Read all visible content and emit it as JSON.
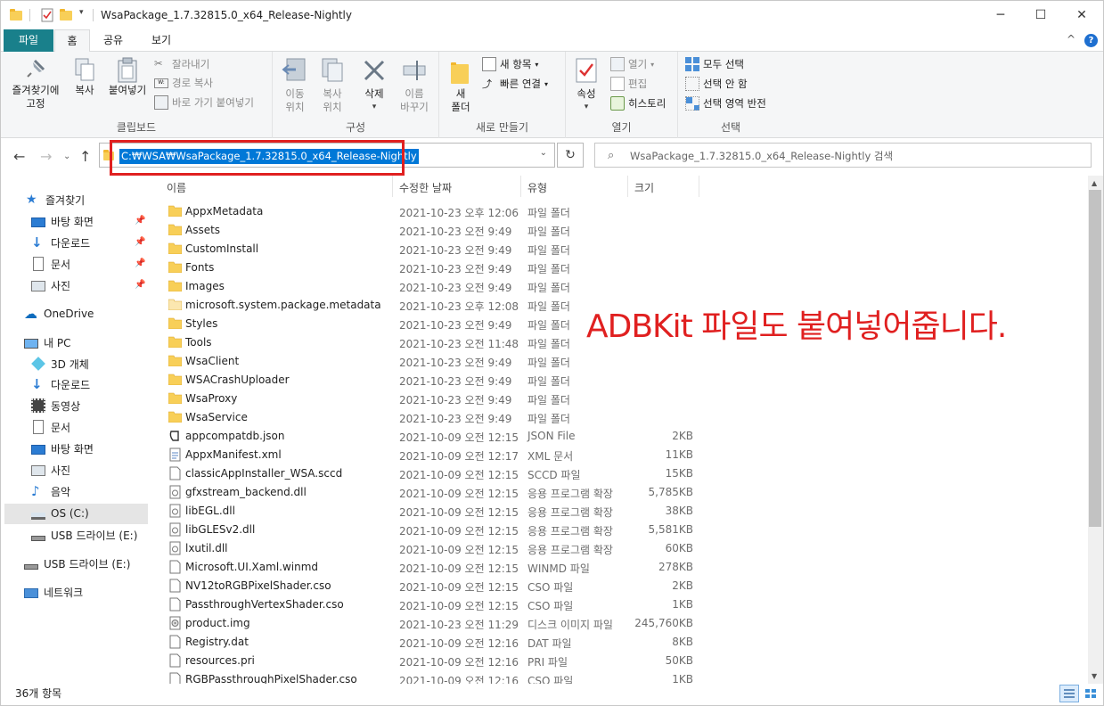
{
  "window": {
    "title": "WsaPackage_1.7.32815.0_x64_Release-Nightly",
    "minimize": "─",
    "maximize": "☐",
    "close": "✕",
    "help": "?",
    "collapse": "^"
  },
  "tabs": {
    "file": "파일",
    "home": "홈",
    "share": "공유",
    "view": "보기"
  },
  "ribbon": {
    "clipboard": {
      "pin_label_1": "즐겨찾기에",
      "pin_label_2": "고정",
      "copy": "복사",
      "paste": "붙여넣기",
      "cut": "잘라내기",
      "copy_path": "경로 복사",
      "paste_shortcut": "바로 가기 붙여넣기",
      "group": "클립보드"
    },
    "organize": {
      "move_1": "이동",
      "move_2": "위치",
      "copyto_1": "복사",
      "copyto_2": "위치",
      "delete": "삭제",
      "rename_1": "이름",
      "rename_2": "바꾸기",
      "group": "구성"
    },
    "new": {
      "new_folder_1": "새",
      "new_folder_2": "폴더",
      "new_item": "새 항목",
      "easy_access": "빠른 연결",
      "group": "새로 만들기"
    },
    "open": {
      "properties": "속성",
      "open": "열기",
      "edit": "편집",
      "history": "히스토리",
      "group": "열기"
    },
    "select": {
      "select_all": "모두 선택",
      "select_none": "선택 안 함",
      "invert": "선택 영역 반전",
      "group": "선택"
    }
  },
  "address": {
    "path": "C:₩WSA₩WsaPackage_1.7.32815.0_x64_Release-Nightly"
  },
  "search": {
    "placeholder": "WsaPackage_1.7.32815.0_x64_Release-Nightly 검색"
  },
  "sidebar": {
    "quick_access": "즐겨찾기",
    "desktop": "바탕 화면",
    "downloads": "다운로드",
    "documents": "문서",
    "pictures": "사진",
    "onedrive": "OneDrive",
    "this_pc": "내 PC",
    "objects3d": "3D 개체",
    "pc_downloads": "다운로드",
    "videos": "동영상",
    "pc_documents": "문서",
    "pc_desktop": "바탕 화면",
    "pc_pictures": "사진",
    "music": "음악",
    "os_c": "OS (C:)",
    "usb_e_1": "USB 드라이브 (E:)",
    "usb_e_2": "USB 드라이브 (E:)",
    "network": "네트워크"
  },
  "columns": {
    "name": "이름",
    "date": "수정한 날짜",
    "type": "유형",
    "size": "크기"
  },
  "files": [
    {
      "name": "AppxMetadata",
      "date": "2021-10-23 오후 12:06",
      "type": "파일 폴더",
      "size": "",
      "kind": "folder"
    },
    {
      "name": "Assets",
      "date": "2021-10-23 오전 9:49",
      "type": "파일 폴더",
      "size": "",
      "kind": "folder"
    },
    {
      "name": "CustomInstall",
      "date": "2021-10-23 오전 9:49",
      "type": "파일 폴더",
      "size": "",
      "kind": "folder"
    },
    {
      "name": "Fonts",
      "date": "2021-10-23 오전 9:49",
      "type": "파일 폴더",
      "size": "",
      "kind": "folder"
    },
    {
      "name": "Images",
      "date": "2021-10-23 오전 9:49",
      "type": "파일 폴더",
      "size": "",
      "kind": "folder"
    },
    {
      "name": "microsoft.system.package.metadata",
      "date": "2021-10-23 오후 12:08",
      "type": "파일 폴더",
      "size": "",
      "kind": "folder-light"
    },
    {
      "name": "Styles",
      "date": "2021-10-23 오전 9:49",
      "type": "파일 폴더",
      "size": "",
      "kind": "folder"
    },
    {
      "name": "Tools",
      "date": "2021-10-23 오전 11:48",
      "type": "파일 폴더",
      "size": "",
      "kind": "folder"
    },
    {
      "name": "WsaClient",
      "date": "2021-10-23 오전 9:49",
      "type": "파일 폴더",
      "size": "",
      "kind": "folder"
    },
    {
      "name": "WSACrashUploader",
      "date": "2021-10-23 오전 9:49",
      "type": "파일 폴더",
      "size": "",
      "kind": "folder"
    },
    {
      "name": "WsaProxy",
      "date": "2021-10-23 오전 9:49",
      "type": "파일 폴더",
      "size": "",
      "kind": "folder"
    },
    {
      "name": "WsaService",
      "date": "2021-10-23 오전 9:49",
      "type": "파일 폴더",
      "size": "",
      "kind": "folder"
    },
    {
      "name": "appcompatdb.json",
      "date": "2021-10-09 오전 12:15",
      "type": "JSON File",
      "size": "2KB",
      "kind": "json"
    },
    {
      "name": "AppxManifest.xml",
      "date": "2021-10-09 오전 12:17",
      "type": "XML 문서",
      "size": "11KB",
      "kind": "xml"
    },
    {
      "name": "classicAppInstaller_WSA.sccd",
      "date": "2021-10-09 오전 12:15",
      "type": "SCCD 파일",
      "size": "15KB",
      "kind": "doc"
    },
    {
      "name": "gfxstream_backend.dll",
      "date": "2021-10-09 오전 12:15",
      "type": "응용 프로그램 확장",
      "size": "5,785KB",
      "kind": "dll"
    },
    {
      "name": "libEGL.dll",
      "date": "2021-10-09 오전 12:15",
      "type": "응용 프로그램 확장",
      "size": "38KB",
      "kind": "dll"
    },
    {
      "name": "libGLESv2.dll",
      "date": "2021-10-09 오전 12:15",
      "type": "응용 프로그램 확장",
      "size": "5,581KB",
      "kind": "dll"
    },
    {
      "name": "lxutil.dll",
      "date": "2021-10-09 오전 12:15",
      "type": "응용 프로그램 확장",
      "size": "60KB",
      "kind": "dll"
    },
    {
      "name": "Microsoft.UI.Xaml.winmd",
      "date": "2021-10-09 오전 12:15",
      "type": "WINMD 파일",
      "size": "278KB",
      "kind": "doc"
    },
    {
      "name": "NV12toRGBPixelShader.cso",
      "date": "2021-10-09 오전 12:15",
      "type": "CSO 파일",
      "size": "2KB",
      "kind": "doc"
    },
    {
      "name": "PassthroughVertexShader.cso",
      "date": "2021-10-09 오전 12:15",
      "type": "CSO 파일",
      "size": "1KB",
      "kind": "doc"
    },
    {
      "name": "product.img",
      "date": "2021-10-23 오전 11:29",
      "type": "디스크 이미지 파일",
      "size": "245,760KB",
      "kind": "img"
    },
    {
      "name": "Registry.dat",
      "date": "2021-10-09 오전 12:16",
      "type": "DAT 파일",
      "size": "8KB",
      "kind": "doc"
    },
    {
      "name": "resources.pri",
      "date": "2021-10-09 오전 12:16",
      "type": "PRI 파일",
      "size": "50KB",
      "kind": "doc"
    },
    {
      "name": "RGBPassthroughPixelShader.cso",
      "date": "2021-10-09 오전 12:16",
      "type": "CSO 파일",
      "size": "1KB",
      "kind": "doc"
    }
  ],
  "annotation": "ADBKit 파일도 붙여넣어줍니다.",
  "status": {
    "count": "36개 항목"
  },
  "colors": {
    "accent": "#0078d7",
    "file_tab": "#19808b",
    "highlight": "#e02020",
    "folder": "#f8cf58"
  }
}
